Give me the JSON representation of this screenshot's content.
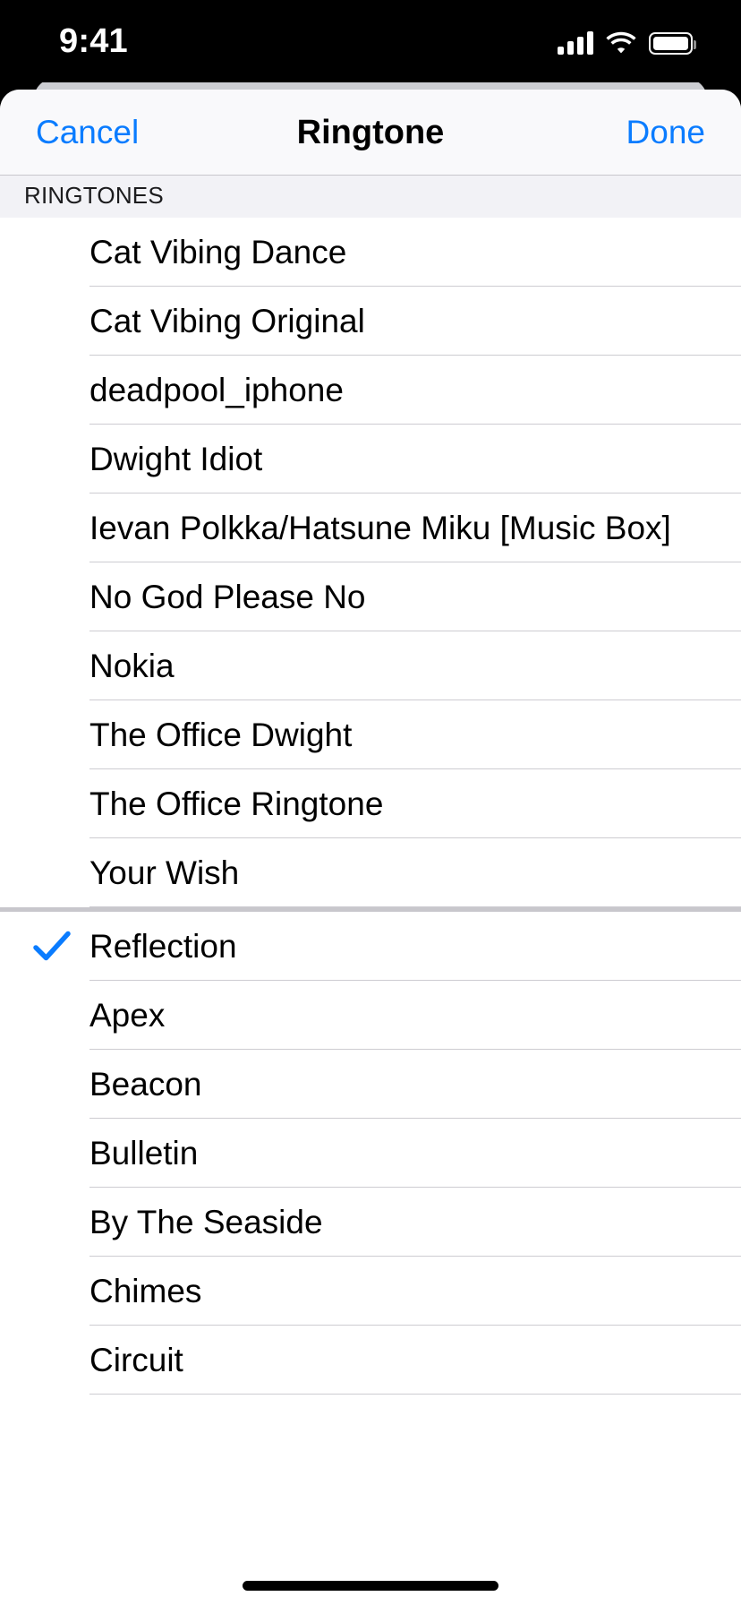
{
  "status_bar": {
    "time": "9:41",
    "cellular_icon": "cellular-bars-icon",
    "wifi_icon": "wifi-icon",
    "battery_icon": "battery-full-icon"
  },
  "navbar": {
    "cancel_label": "Cancel",
    "title": "Ringtone",
    "done_label": "Done",
    "accent_color": "#0a7cff"
  },
  "sections": [
    {
      "header": "RINGTONES",
      "items": [
        {
          "label": "Cat Vibing Dance",
          "selected": false
        },
        {
          "label": "Cat Vibing Original",
          "selected": false
        },
        {
          "label": "deadpool_iphone",
          "selected": false
        },
        {
          "label": "Dwight Idiot",
          "selected": false
        },
        {
          "label": "Ievan Polkka/Hatsune Miku [Music Box]",
          "selected": false
        },
        {
          "label": "No God Please No",
          "selected": false
        },
        {
          "label": "Nokia",
          "selected": false
        },
        {
          "label": "The Office Dwight",
          "selected": false
        },
        {
          "label": "The Office Ringtone",
          "selected": false
        },
        {
          "label": "Your Wish",
          "selected": false
        }
      ]
    },
    {
      "header": "",
      "items": [
        {
          "label": "Reflection",
          "selected": true
        },
        {
          "label": "Apex",
          "selected": false
        },
        {
          "label": "Beacon",
          "selected": false
        },
        {
          "label": "Bulletin",
          "selected": false
        },
        {
          "label": "By The Seaside",
          "selected": false
        },
        {
          "label": "Chimes",
          "selected": false
        },
        {
          "label": "Circuit",
          "selected": false
        }
      ]
    }
  ],
  "checkmark_color": "#0a7cff",
  "home_indicator": "home-indicator"
}
